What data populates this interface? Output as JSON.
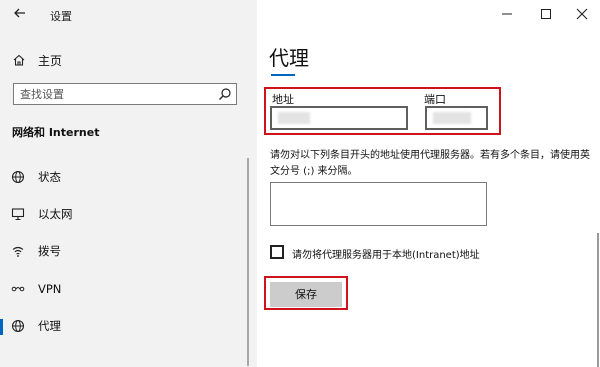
{
  "window": {
    "title": "设置"
  },
  "sidebar": {
    "home_label": "主页",
    "search_placeholder": "查找设置",
    "section_title": "网络和 Internet",
    "items": [
      {
        "label": "状态",
        "icon": "globe-icon"
      },
      {
        "label": "以太网",
        "icon": "monitor-icon"
      },
      {
        "label": "拨号",
        "icon": "signal-icon"
      },
      {
        "label": "VPN",
        "icon": "vpn-icon"
      },
      {
        "label": "代理",
        "icon": "globe-icon",
        "selected": true
      }
    ]
  },
  "main": {
    "page_title": "代理",
    "address_label": "地址",
    "port_label": "端口",
    "exceptions_description": "请勿对以下列条目开头的地址使用代理服务器。若有多个条目，请使用英文分号 (;) 来分隔。",
    "local_checkbox_label": "请勿将代理服务器用于本地(Intranet)地址",
    "local_checkbox_checked": false,
    "save_label": "保存"
  },
  "colors": {
    "accent": "#0067c0",
    "highlight": "#d0121b",
    "sidebar_bg": "#f2f2f2"
  }
}
